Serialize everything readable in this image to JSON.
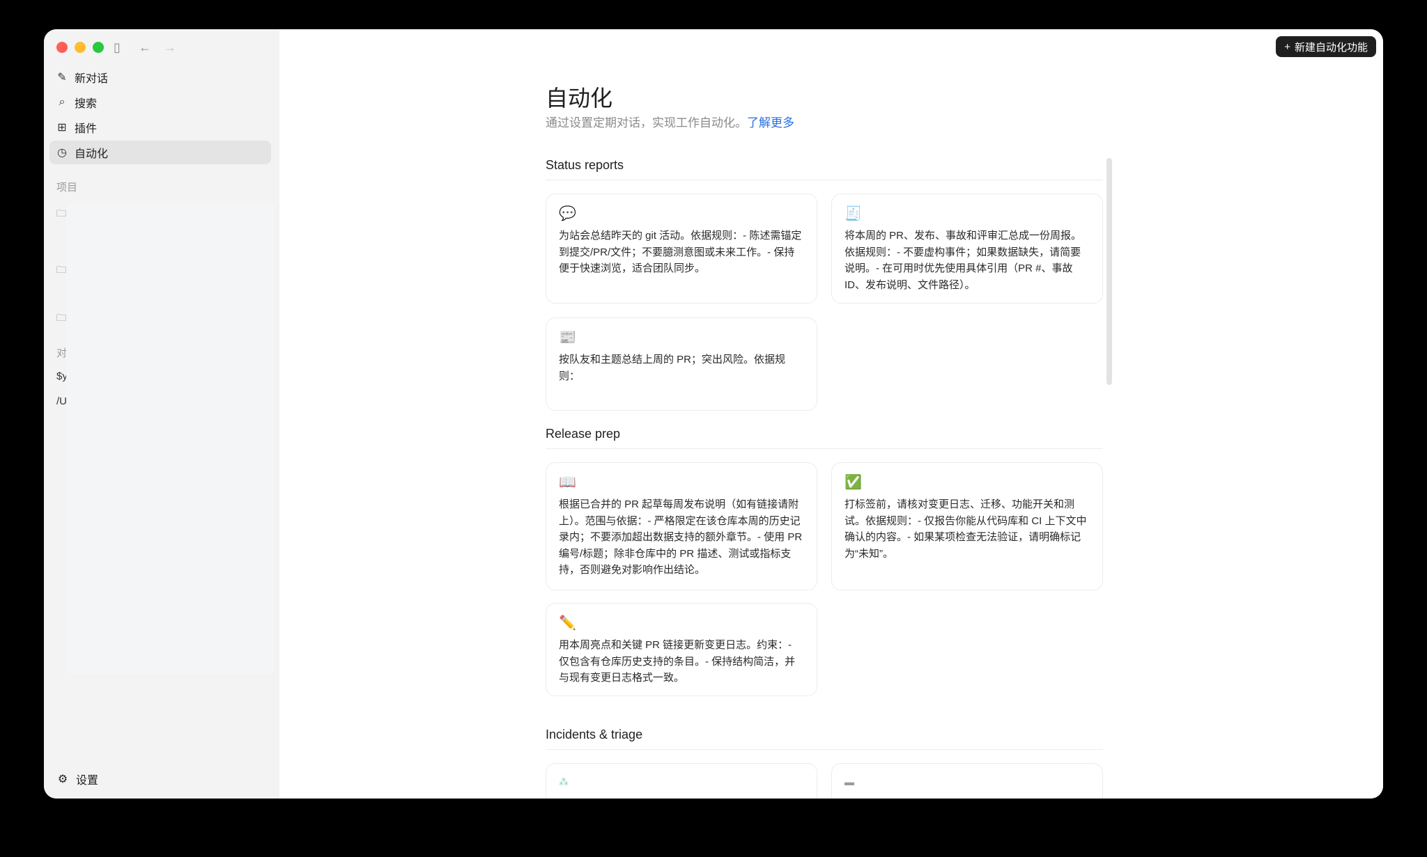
{
  "window": {
    "back_icon": "←",
    "forward_icon": "→",
    "sidebar_toggle_icon": "▯"
  },
  "sidebar": {
    "items": [
      {
        "label": "新对话",
        "icon": "✎",
        "icon_name": "edit-icon"
      },
      {
        "label": "搜索",
        "icon": "⌕",
        "icon_name": "search-icon"
      },
      {
        "label": "插件",
        "icon": "⊞",
        "icon_name": "plugin-icon"
      },
      {
        "label": "自动化",
        "icon": "◷",
        "icon_name": "clock-icon",
        "active": true
      }
    ],
    "projects_label": "项目",
    "conversations_label": "对",
    "truncated_items": [
      "$y",
      "/U"
    ],
    "settings_label": "设置"
  },
  "header": {
    "new_button_label": "新建自动化功能",
    "new_button_icon": "+"
  },
  "page": {
    "title": "自动化",
    "subtitle": "通过设置定期对话，实现工作自动化。",
    "learn_more": "了解更多"
  },
  "sections": [
    {
      "title": "Status reports",
      "cards": [
        {
          "emoji": "💬",
          "text": "为站会总结昨天的 git 活动。依据规则：- 陈述需锚定到提交/PR/文件；不要臆测意图或未来工作。- 保持便于快速浏览，适合团队同步。"
        },
        {
          "emoji": "🧾",
          "text": "将本周的 PR、发布、事故和评审汇总成一份周报。依据规则：- 不要虚构事件；如果数据缺失，请简要说明。- 在可用时优先使用具体引用（PR #、事故 ID、发布说明、文件路径）。"
        },
        {
          "emoji": "📰",
          "text": "按队友和主题总结上周的 PR；突出风险。依据规则："
        }
      ]
    },
    {
      "title": "Release prep",
      "cards": [
        {
          "emoji": "📖",
          "text": "根据已合并的 PR 起草每周发布说明（如有链接请附上）。范围与依据：- 严格限定在该仓库本周的历史记录内；不要添加超出数据支持的额外章节。- 使用 PR 编号/标题；除非仓库中的 PR 描述、测试或指标支持，否则避免对影响作出结论。"
        },
        {
          "emoji": "✅",
          "text": "打标签前，请核对变更日志、迁移、功能开关和测试。依据规则：- 仅报告你能从代码库和 CI 上下文中确认的内容。- 如果某项检查无法验证，请明确标记为“未知”。"
        },
        {
          "emoji": "✏️",
          "text": "用本周亮点和关键 PR 链接更新变更日志。约束：- 仅包含有仓库历史支持的条目。- 保持结构简洁，并与现有变更日志格式一致。"
        }
      ]
    },
    {
      "title": "Incidents & triage",
      "cards": []
    }
  ],
  "colors": {
    "accent_link": "#2b6ee0",
    "button_bg": "#1f1f1f",
    "sidebar_bg": "#f3f3f3"
  }
}
